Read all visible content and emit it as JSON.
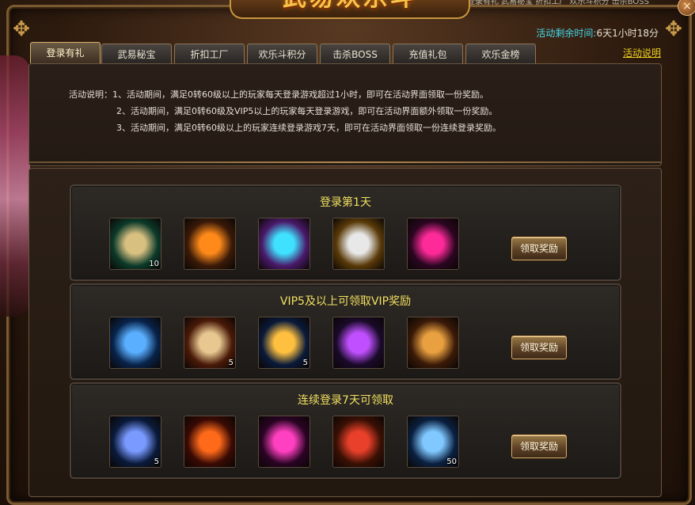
{
  "title": "武易欢乐斗",
  "top_strip_text": "登录有礼  武易秘宝  折扣工厂  欢乐斗积分  击杀BOSS",
  "close_label": "×",
  "timer": {
    "label": "活动剩余时间:",
    "value": "6天1小时18分"
  },
  "tabs": [
    {
      "label": "登录有礼",
      "active": true
    },
    {
      "label": "武易秘宝"
    },
    {
      "label": "折扣工厂"
    },
    {
      "label": "欢乐斗积分"
    },
    {
      "label": "击杀BOSS"
    },
    {
      "label": "充值礼包"
    },
    {
      "label": "欢乐金榜"
    }
  ],
  "help_link": "活动说明",
  "description": {
    "line1": "活动说明：1、活动期间，满足0转60级以上的玩家每天登录游戏超过1小时，即可在活动界面领取一份奖励。",
    "line2": "2、活动期间，满足0转60级及VIP5以上的玩家每天登录游戏，即可在活动界面额外领取一份奖励。",
    "line3": "3、活动期间，满足0转60级以上的玩家连续登录游戏7天，即可在活动界面领取一份连续登录奖励。"
  },
  "sections": [
    {
      "title": "登录第1天",
      "button": "领取奖励",
      "items": [
        {
          "icon": "jade-ring-icon",
          "count": "10",
          "colors": [
            "#0c3a2a",
            "#d8c080"
          ]
        },
        {
          "icon": "fire-orb-icon",
          "count": "",
          "colors": [
            "#3a1a08",
            "#ff8a1a"
          ]
        },
        {
          "icon": "cyan-orb-icon",
          "count": "",
          "colors": [
            "#4a1a6a",
            "#40e0ff"
          ]
        },
        {
          "icon": "silver-ingot-icon",
          "count": "",
          "colors": [
            "#5a3a08",
            "#e8e8e8"
          ]
        },
        {
          "icon": "magenta-orb-icon",
          "count": "",
          "colors": [
            "#2a0620",
            "#ff2a9a"
          ]
        }
      ]
    },
    {
      "title": "VIP5及以上可领取VIP奖励",
      "button": "领取奖励",
      "items": [
        {
          "icon": "blue-crossbow-icon",
          "count": "",
          "colors": [
            "#08234a",
            "#5ab0ff"
          ]
        },
        {
          "icon": "gem-pouch-icon",
          "count": "5",
          "colors": [
            "#4a1a08",
            "#e8c890"
          ]
        },
        {
          "icon": "blue-potion-icon",
          "count": "5",
          "colors": [
            "#0a1a3a",
            "#ffc040"
          ]
        },
        {
          "icon": "purple-orb-icon",
          "count": "",
          "colors": [
            "#1a0a2a",
            "#c050ff"
          ]
        },
        {
          "icon": "treasure-chest-icon",
          "count": "",
          "colors": [
            "#3a1a08",
            "#e8a040"
          ]
        }
      ]
    },
    {
      "title": "连续登录7天可领取",
      "button": "领取奖励",
      "items": [
        {
          "icon": "armor-icon",
          "count": "5",
          "colors": [
            "#0a1a3a",
            "#7a9aff"
          ]
        },
        {
          "icon": "red-orb-icon",
          "count": "",
          "colors": [
            "#3a0a04",
            "#ff6a1a"
          ]
        },
        {
          "icon": "pink-orb-icon",
          "count": "",
          "colors": [
            "#2a0424",
            "#ff40c0"
          ]
        },
        {
          "icon": "red-giftbox-icon",
          "count": "",
          "colors": [
            "#3a1004",
            "#e8402a"
          ]
        },
        {
          "icon": "blue-vase-icon",
          "count": "50",
          "colors": [
            "#0a2040",
            "#80c8ff"
          ]
        }
      ]
    }
  ]
}
